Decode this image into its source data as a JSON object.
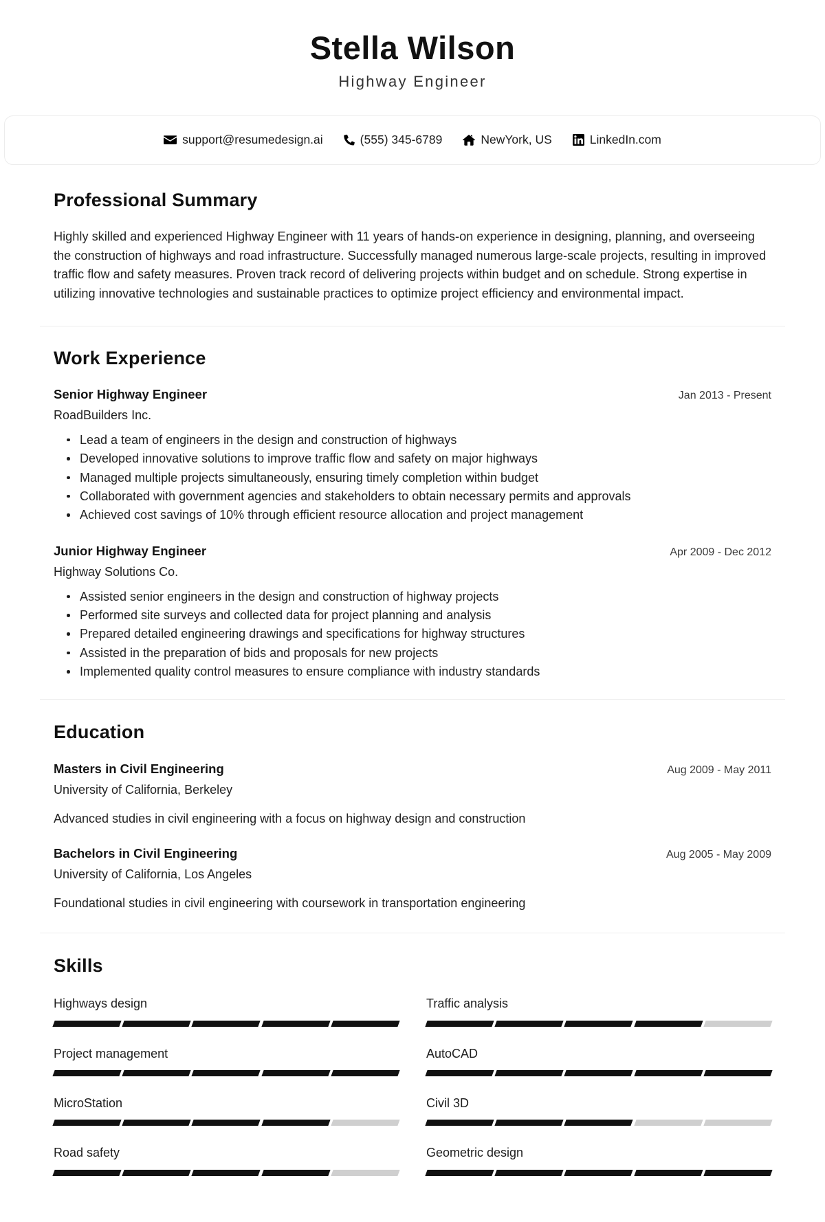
{
  "header": {
    "name": "Stella Wilson",
    "job_title": "Highway Engineer"
  },
  "contact": [
    {
      "icon": "envelope-icon",
      "label": "support@resumedesign.ai"
    },
    {
      "icon": "phone-icon",
      "label": "(555) 345-6789"
    },
    {
      "icon": "home-icon",
      "label": "NewYork, US"
    },
    {
      "icon": "linkedin-icon",
      "label": "LinkedIn.com"
    }
  ],
  "summary": {
    "title": "Professional Summary",
    "text": "Highly skilled and experienced Highway Engineer with 11 years of hands-on experience in designing, planning, and overseeing the construction of highways and road infrastructure. Successfully managed numerous large-scale projects, resulting in improved traffic flow and safety measures. Proven track record of delivering projects within budget and on schedule. Strong expertise in utilizing innovative technologies and sustainable practices to optimize project efficiency and environmental impact."
  },
  "experience": {
    "title": "Work Experience",
    "entries": [
      {
        "role": "Senior Highway Engineer",
        "date": "Jan 2013 - Present",
        "org": "RoadBuilders Inc.",
        "bullets": [
          "Lead a team of engineers in the design and construction of highways",
          "Developed innovative solutions to improve traffic flow and safety on major highways",
          "Managed multiple projects simultaneously, ensuring timely completion within budget",
          "Collaborated with government agencies and stakeholders to obtain necessary permits and approvals",
          "Achieved cost savings of 10% through efficient resource allocation and project management"
        ]
      },
      {
        "role": "Junior Highway Engineer",
        "date": "Apr 2009 - Dec 2012",
        "org": "Highway Solutions Co.",
        "bullets": [
          "Assisted senior engineers in the design and construction of highway projects",
          "Performed site surveys and collected data for project planning and analysis",
          "Prepared detailed engineering drawings and specifications for highway structures",
          "Assisted in the preparation of bids and proposals for new projects",
          "Implemented quality control measures to ensure compliance with industry standards"
        ]
      }
    ]
  },
  "education": {
    "title": "Education",
    "entries": [
      {
        "degree": "Masters in Civil Engineering",
        "date": "Aug 2009 - May 2011",
        "school": "University of California, Berkeley",
        "description": "Advanced studies in civil engineering with a focus on highway design and construction"
      },
      {
        "degree": "Bachelors in Civil Engineering",
        "date": "Aug 2005 - May 2009",
        "school": "University of California, Los Angeles",
        "description": "Foundational studies in civil engineering with coursework in transportation engineering"
      }
    ]
  },
  "skills": {
    "title": "Skills",
    "max_rating": 5,
    "items": [
      {
        "name": "Highways design",
        "rating": 5
      },
      {
        "name": "Traffic analysis",
        "rating": 4
      },
      {
        "name": "Project management",
        "rating": 5
      },
      {
        "name": "AutoCAD",
        "rating": 5
      },
      {
        "name": "MicroStation",
        "rating": 4
      },
      {
        "name": "Civil 3D",
        "rating": 3
      },
      {
        "name": "Road safety",
        "rating": 4
      },
      {
        "name": "Geometric design",
        "rating": 5
      }
    ]
  },
  "colors": {
    "text": "#1a1a1a",
    "filled_segment": "#111111",
    "empty_segment": "#cfcfcf",
    "divider": "#ededed",
    "card_border": "#ececec"
  }
}
